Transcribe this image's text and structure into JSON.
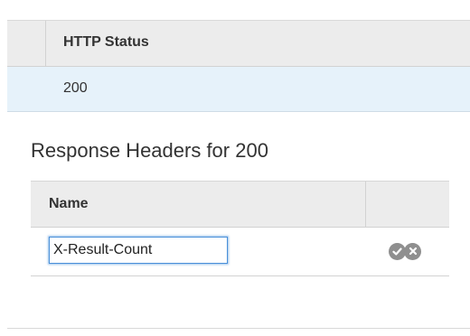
{
  "status_table": {
    "header_label": "HTTP Status",
    "rows": [
      {
        "status": "200"
      }
    ]
  },
  "response_headers": {
    "title": "Response Headers for 200",
    "columns": {
      "name_label": "Name"
    },
    "rows": [
      {
        "name_value": "X-Result-Count"
      }
    ]
  },
  "icons": {
    "confirm": "check-circle-icon",
    "remove": "close-circle-icon"
  },
  "colors": {
    "selected_row": "#e6f2fa",
    "header_bg": "#ececec",
    "input_focus": "#4a90d9",
    "icon_fill": "#8f8f8f"
  }
}
